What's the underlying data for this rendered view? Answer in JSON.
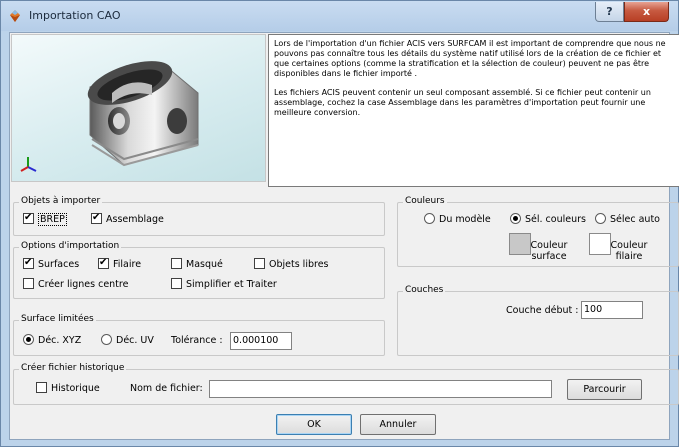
{
  "window": {
    "title": "Importation CAO",
    "help_label": "?",
    "close_label": "x"
  },
  "info": {
    "paragraph1": "Lors de l'importation d'un fichier ACIS vers SURFCAM il est important de comprendre que nous ne pouvons pas connaître tous les détails du système natif utilisé lors de la création de ce fichier et que certaines options (comme la stratification et la sélection de couleur) peuvent ne pas être disponibles dans le fichier importé .",
    "paragraph2": "Les fichiers ACIS peuvent contenir un seul composant assemblé. Si ce fichier peut contenir un assemblage, cochez la case  Assemblage dans les paramètres d'importation peut fournir une meilleure conversion."
  },
  "objects": {
    "legend": "Objets à importer",
    "brep": {
      "label": "BREP",
      "checked": true
    },
    "assemblage": {
      "label": "Assemblage",
      "checked": true
    }
  },
  "options": {
    "legend": "Options d'importation",
    "surfaces": {
      "label": "Surfaces",
      "checked": true
    },
    "filaire": {
      "label": "Filaire",
      "checked": true
    },
    "masque": {
      "label": "Masqué",
      "checked": false
    },
    "objets_libres": {
      "label": "Objets libres",
      "checked": false
    },
    "lignes_centre": {
      "label": "Créer lignes centre",
      "checked": false
    },
    "simplifier": {
      "label": "Simplifier et Traiter",
      "checked": false
    }
  },
  "surface": {
    "legend": "Surface limitées",
    "dec_xyz": {
      "label": "Déc. XYZ",
      "selected": true
    },
    "dec_uv": {
      "label": "Déc. UV",
      "selected": false
    },
    "tolerance_label": "Tolérance :",
    "tolerance_value": "0.000100"
  },
  "colors": {
    "legend": "Couleurs",
    "du_modele": {
      "label": "Du modèle",
      "selected": false
    },
    "sel_couleurs": {
      "label": "Sél. couleurs",
      "selected": true
    },
    "selec_auto": {
      "label": "Sélec auto",
      "selected": false
    },
    "surface_swatch": {
      "line1": "Couleur",
      "line2": "surface",
      "color": "#c8c8c8"
    },
    "filaire_swatch": {
      "line1": "Couleur",
      "line2": "filaire",
      "color": "#ffffff"
    }
  },
  "layers": {
    "legend": "Couches",
    "start_label": "Couche début :",
    "start_value": "100"
  },
  "history": {
    "legend": "Créer fichier historique",
    "historique": {
      "label": "Historique",
      "checked": false
    },
    "filename_label": "Nom de fichier:",
    "filename_value": "",
    "browse_label": "Parcourir"
  },
  "footer": {
    "ok_label": "OK",
    "cancel_label": "Annuler"
  }
}
